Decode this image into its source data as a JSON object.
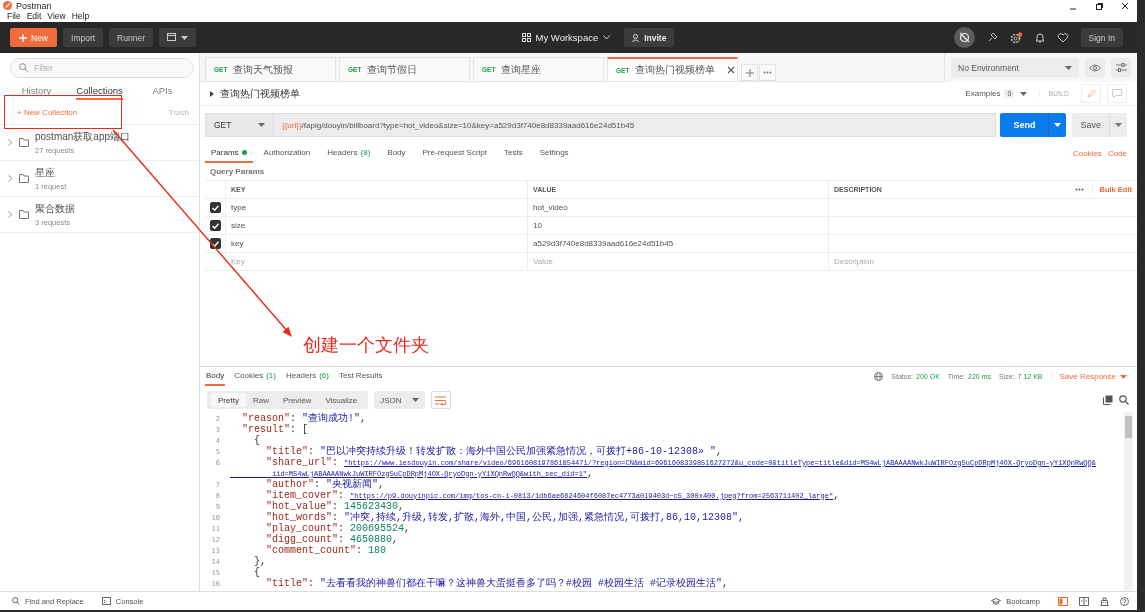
{
  "window": {
    "title": "Postman"
  },
  "menu": [
    "File",
    "Edit",
    "View",
    "Help"
  ],
  "header": {
    "buttons": [
      "New",
      "Import",
      "Runner"
    ],
    "workspace": "My Workspace",
    "invite": "Invite",
    "sign_in": "Sign In"
  },
  "sidebar": {
    "filter_placeholder": "Filter",
    "tabs": [
      {
        "label": "History",
        "selected": false
      },
      {
        "label": "Collections",
        "selected": true
      },
      {
        "label": "APIs",
        "selected": false
      }
    ],
    "new_collection": "+ New Collection",
    "trash": "Trash",
    "collections": [
      {
        "name": "postman获取app端口",
        "count": "27 requests"
      },
      {
        "name": "星座",
        "count": "1 request"
      },
      {
        "name": "聚合数据",
        "count": "3 requests"
      }
    ]
  },
  "request_tabs": [
    {
      "method": "GET",
      "title": "查询天气预报",
      "selected": false
    },
    {
      "method": "GET",
      "title": "查询节假日",
      "selected": false
    },
    {
      "method": "GET",
      "title": "查询星座",
      "selected": false
    },
    {
      "method": "GET",
      "title": "查询热门视频榜单",
      "selected": true
    }
  ],
  "environment": "No Environment",
  "request": {
    "name": "查询热门视频榜单",
    "examples_label": "Examples",
    "examples_count": "0",
    "build": "BUILD",
    "method": "GET",
    "url_variable": "{{url}}",
    "url_path": "/fapig/douyin/billboard?type=hot_video&size=10&key=a529d3f740e8d8339aad616e24d51b45",
    "send": "Send",
    "save": "Save"
  },
  "request_sections": [
    {
      "label": "Params",
      "dot": true,
      "selected": true
    },
    {
      "label": "Authorization",
      "selected": false
    },
    {
      "label": "Headers",
      "count": "(8)",
      "selected": false
    },
    {
      "label": "Body",
      "selected": false
    },
    {
      "label": "Pre-request Script",
      "selected": false
    },
    {
      "label": "Tests",
      "selected": false
    },
    {
      "label": "Settings",
      "selected": false
    }
  ],
  "request_links": [
    "Cookies",
    "Code"
  ],
  "query_params": {
    "title": "Query Params",
    "columns": [
      "KEY",
      "VALUE",
      "DESCRIPTION"
    ],
    "bulk_edit": "Bulk Edit",
    "rows": [
      {
        "key": "type",
        "value": "hot_video",
        "checked": true
      },
      {
        "key": "size",
        "value": "10",
        "checked": true
      },
      {
        "key": "key",
        "value": "a529d3f740e8d8339aad616e24d51b45",
        "checked": true
      }
    ],
    "placeholders": {
      "key": "Key",
      "value": "Value",
      "description": "Description"
    }
  },
  "response": {
    "tabs": [
      {
        "label": "Body",
        "selected": true
      },
      {
        "label": "Cookies",
        "count": "(1)",
        "selected": false
      },
      {
        "label": "Headers",
        "count": "(6)",
        "selected": false
      },
      {
        "label": "Test Results",
        "selected": false
      }
    ],
    "status_label": "Status:",
    "status": "200 OK",
    "time_label": "Time:",
    "time": "220 ms",
    "size_label": "Size:",
    "size": "7.12 KB",
    "save_response": "Save Response",
    "views": [
      {
        "label": "Pretty",
        "selected": true
      },
      {
        "label": "Raw",
        "selected": false
      },
      {
        "label": "Preview",
        "selected": false
      },
      {
        "label": "Visualize",
        "selected": false
      }
    ],
    "format": "JSON",
    "code": [
      {
        "num": "2",
        "parts": [
          {
            "kind": "k",
            "text": "  \"reason\""
          },
          {
            "kind": "p",
            "text": ": "
          },
          {
            "kind": "s",
            "text": "\"查询成功!\""
          },
          {
            "kind": "p",
            "text": ","
          }
        ]
      },
      {
        "num": "3",
        "parts": [
          {
            "kind": "k",
            "text": "  \"result\""
          },
          {
            "kind": "p",
            "text": ": ["
          }
        ]
      },
      {
        "num": "4",
        "parts": [
          {
            "kind": "p",
            "text": "    {"
          }
        ]
      },
      {
        "num": "5",
        "parts": [
          {
            "kind": "k",
            "text": "      \"title\""
          },
          {
            "kind": "p",
            "text": ": "
          },
          {
            "kind": "s",
            "text": "\"巴以冲突持续升级！转发扩散：海外中国公民加强紧急情况，可拨打+86-10-12308» \""
          },
          {
            "kind": "p",
            "text": ","
          }
        ]
      },
      {
        "num": "6",
        "parts": [
          {
            "kind": "k",
            "text": "      \"share_url\""
          },
          {
            "kind": "p",
            "text": ": "
          },
          {
            "kind": "link",
            "text": "\"https://www.iesdouyin.com/share/video/6961608197861854471/?region=CN&mid=6961608339851627272&u_code=0&titleType=title&did=MS4wLjABAAAANwkJuWIRFOzg5uCpDRpMj4OX-QryoDgn-yY1XQnRwQQ&"
          }
        ]
      },
      {
        "parts": [
          {
            "kind": "link",
            "text": "          iid=MS4wLjABAAAANwkJuWIRFOzg5uCpDRpMj4OX-QryoDgn-yY1XQnRwQQ&with_sec_did=1\""
          },
          {
            "kind": "p",
            "text": ","
          }
        ]
      },
      {
        "num": "7",
        "parts": [
          {
            "kind": "k",
            "text": "      \"author\""
          },
          {
            "kind": "p",
            "text": ": "
          },
          {
            "kind": "s",
            "text": "\"央视新闻\""
          },
          {
            "kind": "p",
            "text": ","
          }
        ]
      },
      {
        "num": "8",
        "parts": [
          {
            "kind": "k",
            "text": "      \"item_cover\""
          },
          {
            "kind": "p",
            "text": ": "
          },
          {
            "kind": "link",
            "text": "\"https://p9.douyinpic.com/img/tos-cn-i-0813/1db6ae6824604f6087ec4773a019403d~c5_300x400.jpeg?from=2563711402_large\""
          },
          {
            "kind": "p",
            "text": ","
          }
        ]
      },
      {
        "num": "9",
        "parts": [
          {
            "kind": "k",
            "text": "      \"hot_value\""
          },
          {
            "kind": "p",
            "text": ": "
          },
          {
            "kind": "n",
            "text": "145623430"
          },
          {
            "kind": "p",
            "text": ","
          }
        ]
      },
      {
        "num": "10",
        "parts": [
          {
            "kind": "k",
            "text": "      \"hot_words\""
          },
          {
            "kind": "p",
            "text": ": "
          },
          {
            "kind": "s",
            "text": "\"冲突,持续,升级,转发,扩散,海外,中国,公民,加强,紧急情况,可拨打,86,10,12308\""
          },
          {
            "kind": "p",
            "text": ","
          }
        ]
      },
      {
        "num": "11",
        "parts": [
          {
            "kind": "k",
            "text": "      \"play_count\""
          },
          {
            "kind": "p",
            "text": ": "
          },
          {
            "kind": "n",
            "text": "200695524"
          },
          {
            "kind": "p",
            "text": ","
          }
        ]
      },
      {
        "num": "12",
        "parts": [
          {
            "kind": "k",
            "text": "      \"digg_count\""
          },
          {
            "kind": "p",
            "text": ": "
          },
          {
            "kind": "n",
            "text": "4650880"
          },
          {
            "kind": "p",
            "text": ","
          }
        ]
      },
      {
        "num": "13",
        "parts": [
          {
            "kind": "k",
            "text": "      \"comment_count\""
          },
          {
            "kind": "p",
            "text": ": "
          },
          {
            "kind": "n",
            "text": "180"
          }
        ]
      },
      {
        "num": "14",
        "parts": [
          {
            "kind": "p",
            "text": "    },"
          }
        ]
      },
      {
        "num": "15",
        "parts": [
          {
            "kind": "p",
            "text": "    {"
          }
        ]
      },
      {
        "num": "16",
        "parts": [
          {
            "kind": "k",
            "text": "      \"title\""
          },
          {
            "kind": "p",
            "text": ": "
          },
          {
            "kind": "s",
            "text": "\"去看看我的神兽们都在干嘛？这神兽大蛋挺香多了吗？#校园 #校园生活 #记录校园生活\""
          },
          {
            "kind": "p",
            "text": ","
          }
        ]
      }
    ]
  },
  "status_bar": {
    "left": [
      "Find and Replace",
      "Console"
    ],
    "bootcamp": "Bootcamp"
  },
  "annotation": {
    "text": "创建一个文件夹"
  }
}
